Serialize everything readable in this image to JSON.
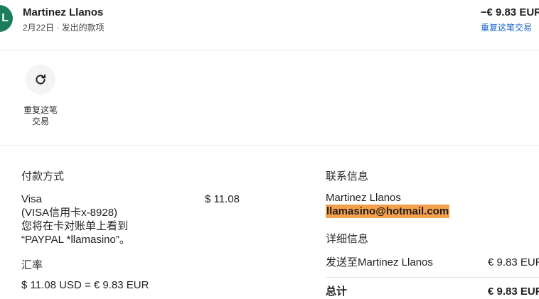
{
  "header": {
    "avatar_letter": "L",
    "merchant": "Martinez Llanos",
    "subline": "2月22日 · 发出的款项",
    "amount": "−€ 9.83 EUR",
    "repeat_link": "重复这笔交易"
  },
  "actions": {
    "repeat_label": "重复这笔\n交易"
  },
  "payment": {
    "title": "付款方式",
    "method_lines": "Visa\n(VISA信用卡x-8928)\n您将在卡对账单上看到\n“PAYPAL *llamasino”。",
    "amount": "$ 11.08",
    "rate_title": "汇率",
    "rate_value": "$ 11.08 USD = € 9.83 EUR"
  },
  "contact": {
    "title": "联系信息",
    "name": "Martinez Llanos",
    "email": "llamasino@hotmail.com"
  },
  "details": {
    "title": "详细信息",
    "sent_label": "发送至Martinez Llanos",
    "sent_value": "€ 9.83 EUR",
    "total_label": "总计",
    "total_value": "€ 9.83 EUR"
  },
  "colors": {
    "avatar": "#1b7e5a",
    "link": "#1a66c7",
    "email_highlight": "#f5a04a"
  },
  "icons": {
    "repeat": "refresh-icon"
  }
}
